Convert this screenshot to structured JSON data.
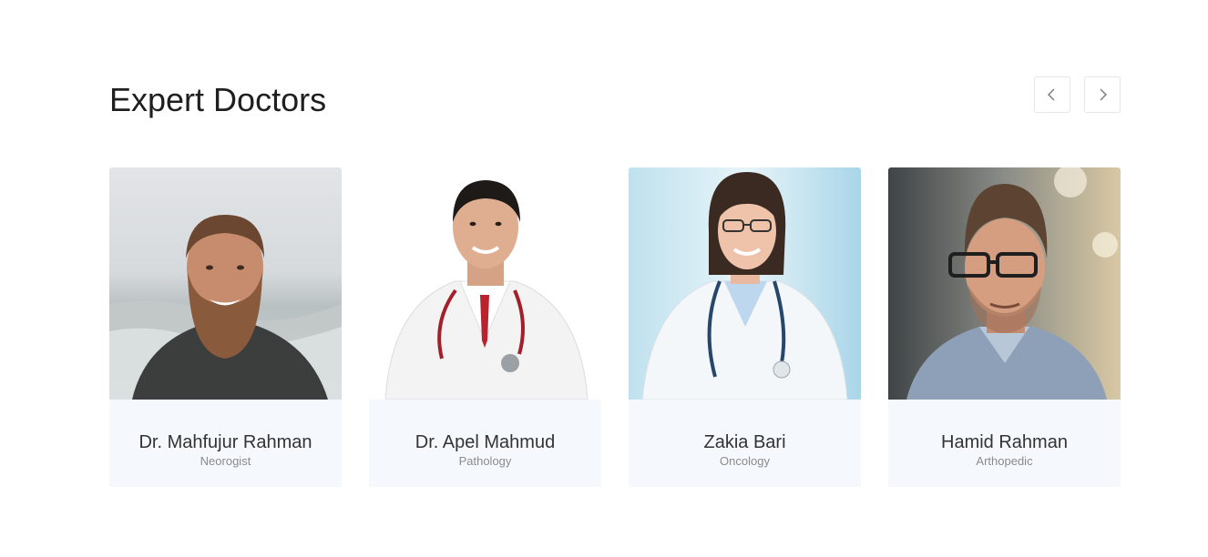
{
  "section": {
    "title": "Expert Doctors"
  },
  "carousel": {
    "prev_icon": "chevron-left-icon",
    "next_icon": "chevron-right-icon"
  },
  "doctors": [
    {
      "name": "Dr. Mahfujur Rahman",
      "specialty": "Neorogist",
      "photo": "bearded-man-portrait"
    },
    {
      "name": "Dr. Apel Mahmud",
      "specialty": "Pathology",
      "photo": "doctor-with-stethoscope-portrait"
    },
    {
      "name": "Zakia Bari",
      "specialty": "Oncology",
      "photo": "female-doctor-portrait"
    },
    {
      "name": "Hamid Rahman",
      "specialty": "Arthopedic",
      "photo": "man-with-glasses-portrait"
    }
  ],
  "colors": {
    "card_info_bg": "#f5f9fd",
    "title": "#1f1f1f",
    "name": "#333333",
    "specialty": "#8a8a8a",
    "button_border": "#e6e6e6"
  }
}
